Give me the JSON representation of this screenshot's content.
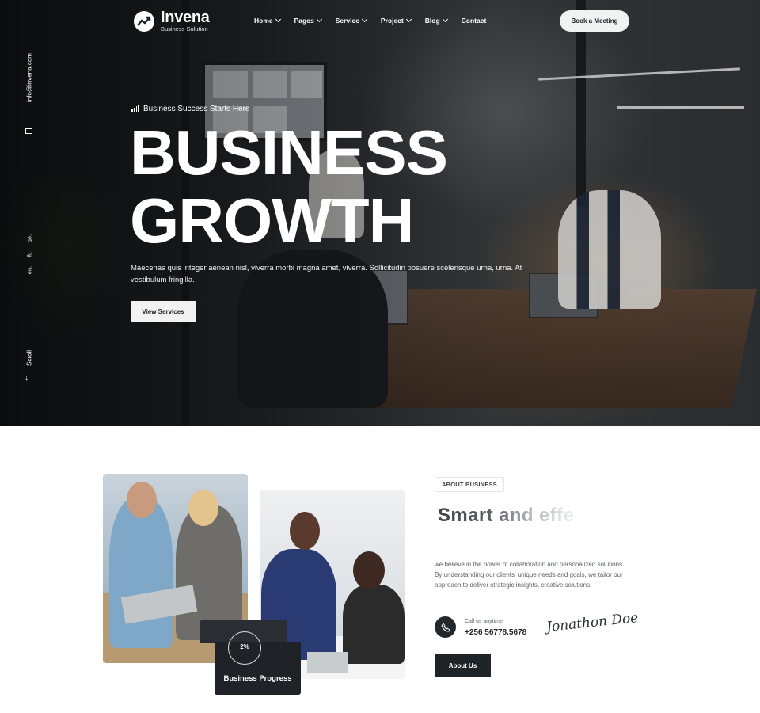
{
  "brand": {
    "name": "Invena",
    "tagline": "Business Solution"
  },
  "nav": {
    "items": [
      {
        "label": "Home",
        "has_dropdown": true
      },
      {
        "label": "Pages",
        "has_dropdown": true
      },
      {
        "label": "Service",
        "has_dropdown": true
      },
      {
        "label": "Project",
        "has_dropdown": true
      },
      {
        "label": "Blog",
        "has_dropdown": true
      },
      {
        "label": "Contact",
        "has_dropdown": false
      }
    ],
    "cta_label": "Book a Meeting"
  },
  "side_rail": {
    "email": "info@invena.com",
    "languages": [
      "ge.",
      "fr.",
      "en."
    ],
    "scroll_label": "Scroll"
  },
  "hero": {
    "eyebrow": "Business Success Starts Here",
    "headline_line1": "BUSINESS",
    "headline_line2": "GROWTH",
    "description": "Maecenas quis integer aenean nisl, viverra morbi magna amet, viverra. Sollicitudin posuere scelerisque urna, urna. At vestibulum fringilla.",
    "button_label": "View Services"
  },
  "about": {
    "badge": "ABOUT BUSINESS",
    "title_visible": "Smart and effe",
    "description": "we believe in the power of collaboration and personalized solutions. By understanding our clients' unique needs and goals, we tailor our approach to deliver strategic insights, creative solutions.",
    "call_label": "Call us anytime",
    "call_number": "+256 56778.5678",
    "signature": "Jonathon Doe",
    "button_label": "About Us",
    "progress": {
      "value": "2%",
      "label": "Business Progress"
    }
  },
  "colors": {
    "dark": "#1f2429",
    "light_button": "#f1f2f2",
    "text_muted": "#5b6066"
  },
  "icons": [
    "logo-arrow-icon",
    "chevron-down-icon",
    "mail-icon",
    "bar-chart-icon",
    "arrow-down-icon",
    "phone-icon"
  ]
}
